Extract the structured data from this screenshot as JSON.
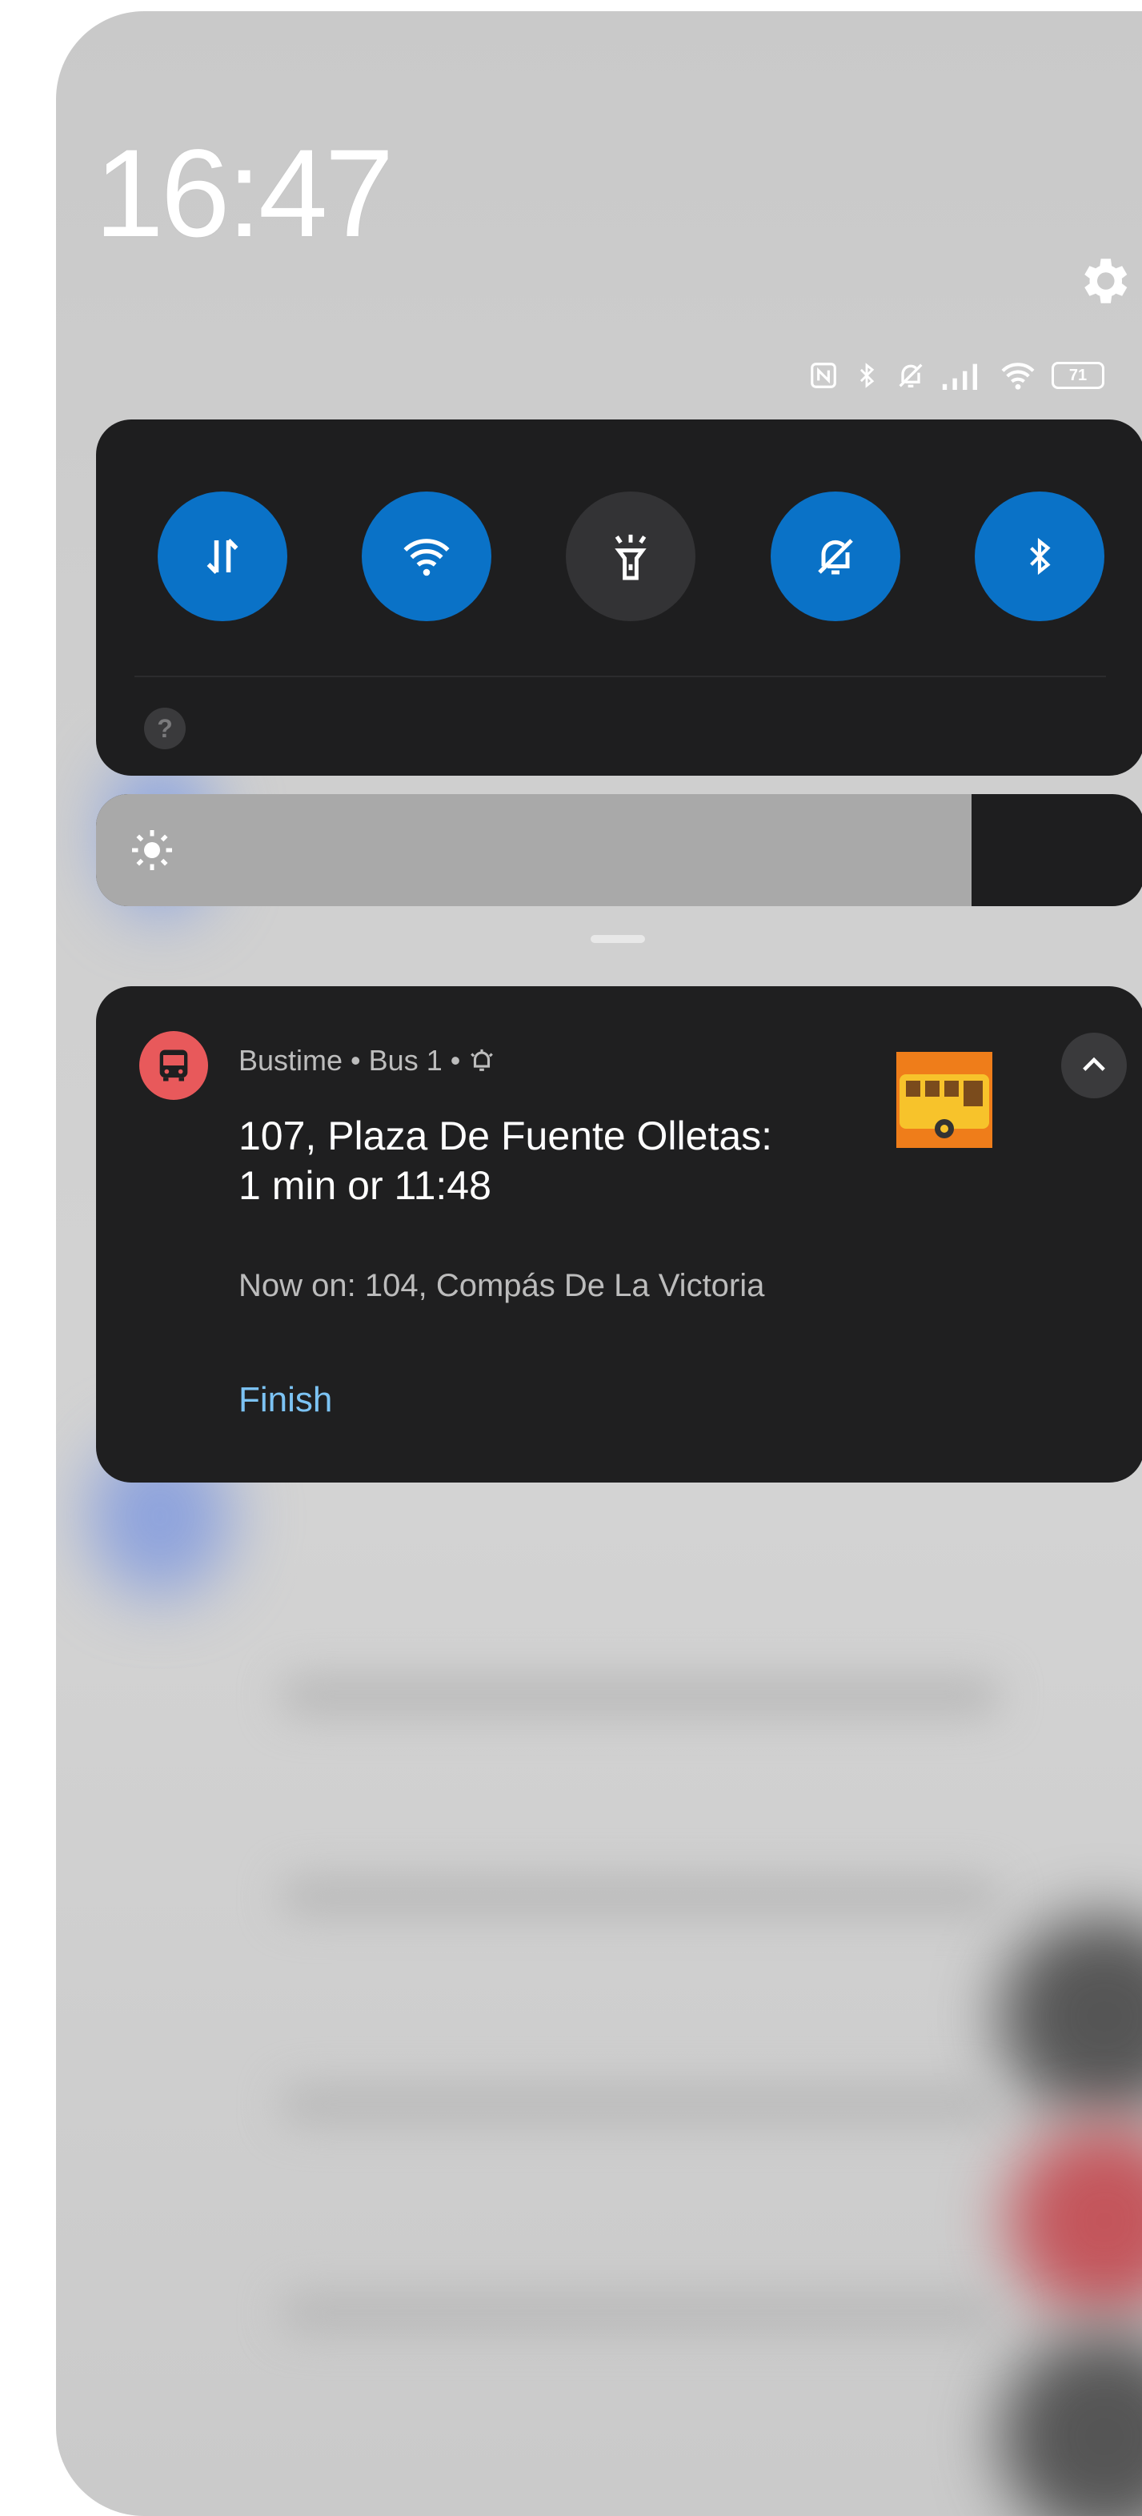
{
  "status": {
    "time": "16:47",
    "battery_level": "71"
  },
  "quick_settings": {
    "toggles": [
      {
        "name": "mobile-data",
        "icon": "data-transfer-icon",
        "active": true
      },
      {
        "name": "wifi",
        "icon": "wifi-icon",
        "active": true
      },
      {
        "name": "flashlight",
        "icon": "flashlight-icon",
        "active": false
      },
      {
        "name": "do-not-disturb",
        "icon": "bell-off-icon",
        "active": true
      },
      {
        "name": "bluetooth",
        "icon": "bluetooth-icon",
        "active": true
      }
    ],
    "help_symbol": "?"
  },
  "brightness": {
    "level": 0.835
  },
  "notification": {
    "app_name": "Bustime",
    "subtitle": "Bus 1",
    "separator": "•",
    "title_line1": "107, Plaza De Fuente Olletas:",
    "title_line2": "1 min or 11:48",
    "body": "Now on: 104, Compás De La Victoria",
    "action_label": "Finish"
  },
  "colors": {
    "toggle_on": "#0a72c7",
    "toggle_off": "#333335",
    "panel": "#1e1e1f",
    "accent_link": "#7cc3f4",
    "app_icon": "#e8595b"
  }
}
